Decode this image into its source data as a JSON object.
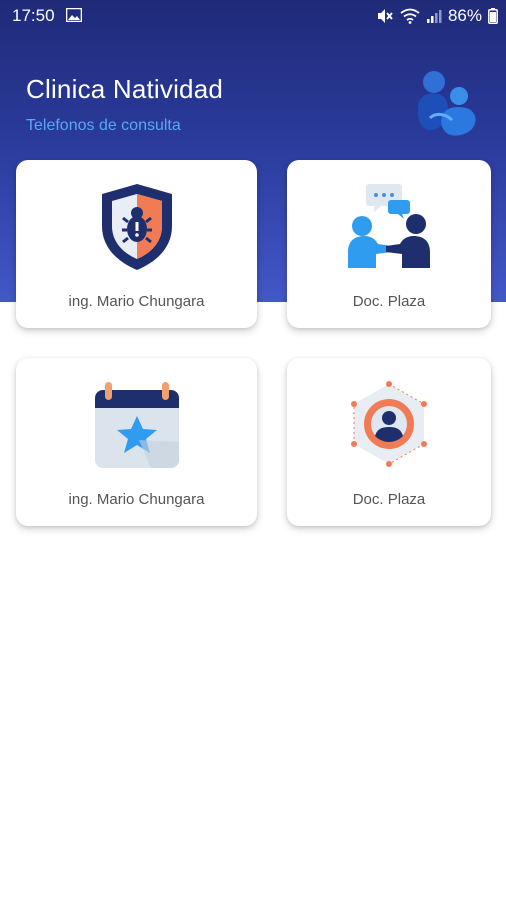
{
  "status_bar": {
    "time": "17:50",
    "battery": "86%"
  },
  "header": {
    "title": "Clinica Natividad",
    "subtitle": "Telefonos de consulta"
  },
  "colors": {
    "header_top": "#1f2a78",
    "header_bottom": "#4358c8",
    "subtitle": "#56a8f5",
    "card_label": "#555555"
  },
  "cards": [
    {
      "label": "ing. Mario Chungara",
      "icon": "security-shield-icon"
    },
    {
      "label": "Doc. Plaza",
      "icon": "consultation-icon"
    },
    {
      "label": "ing. Mario Chungara",
      "icon": "calendar-star-icon"
    },
    {
      "label": "Doc. Plaza",
      "icon": "user-network-icon"
    }
  ]
}
